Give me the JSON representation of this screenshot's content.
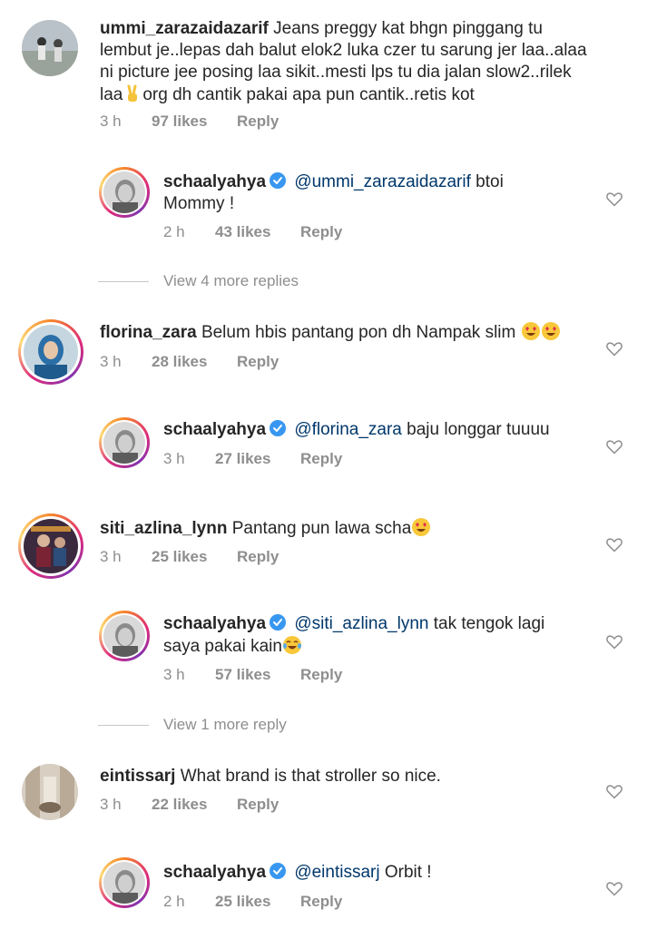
{
  "comments": [
    {
      "user": "ummi_zarazaidazarif",
      "lines": [
        "Jeans preggy kat bhgn pinggang tu",
        "lembut je..lepas dah balut elok2 luka czer tu sarung jer laa..alaa",
        "ni picture jee posing laa sikit..mesti lps tu dia jalan slow2..rilek",
        "laa",
        "org dh cantik pakai apa pun cantik..retis kot"
      ],
      "time": "3 h",
      "likes": "97 likes",
      "reply": "Reply"
    },
    {
      "user": "schaalyahya",
      "mention": "@ummi_zarazaidazarif",
      "text1": "btoi",
      "text2": "Mommy !",
      "time": "2 h",
      "likes": "43 likes",
      "reply": "Reply"
    },
    {
      "view_more": "View 4 more replies"
    },
    {
      "user": "florina_zara",
      "text": "Belum hbis pantang pon dh Nampak slim",
      "time": "3 h",
      "likes": "28 likes",
      "reply": "Reply"
    },
    {
      "user": "schaalyahya",
      "mention": "@florina_zara",
      "text": "baju longgar tuuuu",
      "time": "3 h",
      "likes": "27 likes",
      "reply": "Reply"
    },
    {
      "user": "siti_azlina_lynn",
      "text": "Pantang pun lawa scha",
      "time": "3 h",
      "likes": "25 likes",
      "reply": "Reply"
    },
    {
      "user": "schaalyahya",
      "mention": "@siti_azlina_lynn",
      "text1": "tak tengok lagi",
      "text2": "saya pakai kain",
      "time": "3 h",
      "likes": "57 likes",
      "reply": "Reply"
    },
    {
      "view_more": "View 1 more reply"
    },
    {
      "user": "eintissarj",
      "text": "What brand is that stroller so nice.",
      "time": "3 h",
      "likes": "22 likes",
      "reply": "Reply"
    },
    {
      "user": "schaalyahya",
      "mention": "@eintissarj",
      "text": "Orbit !",
      "time": "2 h",
      "likes": "25 likes",
      "reply": "Reply"
    }
  ],
  "colors": {
    "text": "#262626",
    "mention": "#00376b",
    "meta": "#8e8e8e",
    "verified": "#3897f0"
  },
  "icons": [
    "heart-icon",
    "verified-badge-icon",
    "victory-hand-emoji",
    "heart-eyes-emoji",
    "tears-of-joy-emoji"
  ]
}
